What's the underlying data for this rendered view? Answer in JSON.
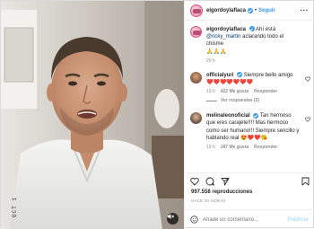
{
  "media": {
    "overlay_text": "OCT 1"
  },
  "header": {
    "username": "elgordoylaflaca",
    "separator": "•",
    "follow_label": "Seguir",
    "more_label": "···"
  },
  "caption": {
    "username": "elgordoylaflaca",
    "text": "Ahí está",
    "mention": "@ricky_martin",
    "text2": "aclarando todo el chisme",
    "emoji": "🙏🙏🙏",
    "time": "20 h"
  },
  "comments": [
    {
      "username": "officialyuri",
      "text": "Siempre bello amigo ❤️❤️❤️❤️❤️❤️❤️",
      "time": "19 h",
      "likes": "422 Me gusta",
      "reply_label": "Responder",
      "replies_label": "Ver respuestas (2)"
    },
    {
      "username": "melinaleonoficial",
      "text": "Tan hermoso que eres carajete!!!! Mas hermoso como ser humano!!! Siempre sencillo y hablando real 😍❤️❤️😘",
      "time": "19 h",
      "likes": "187 Me gusta",
      "reply_label": "Responder"
    }
  ],
  "stats": {
    "views": "997.558 reproducciones",
    "date": "HACE 20 HORAS"
  },
  "add_comment": {
    "placeholder": "Añade un comentario...",
    "publish_label": "Publicar"
  },
  "colors": {
    "link": "#3897f0",
    "muted": "#8e8e8e",
    "publish_disabled": "#b2dffc"
  }
}
